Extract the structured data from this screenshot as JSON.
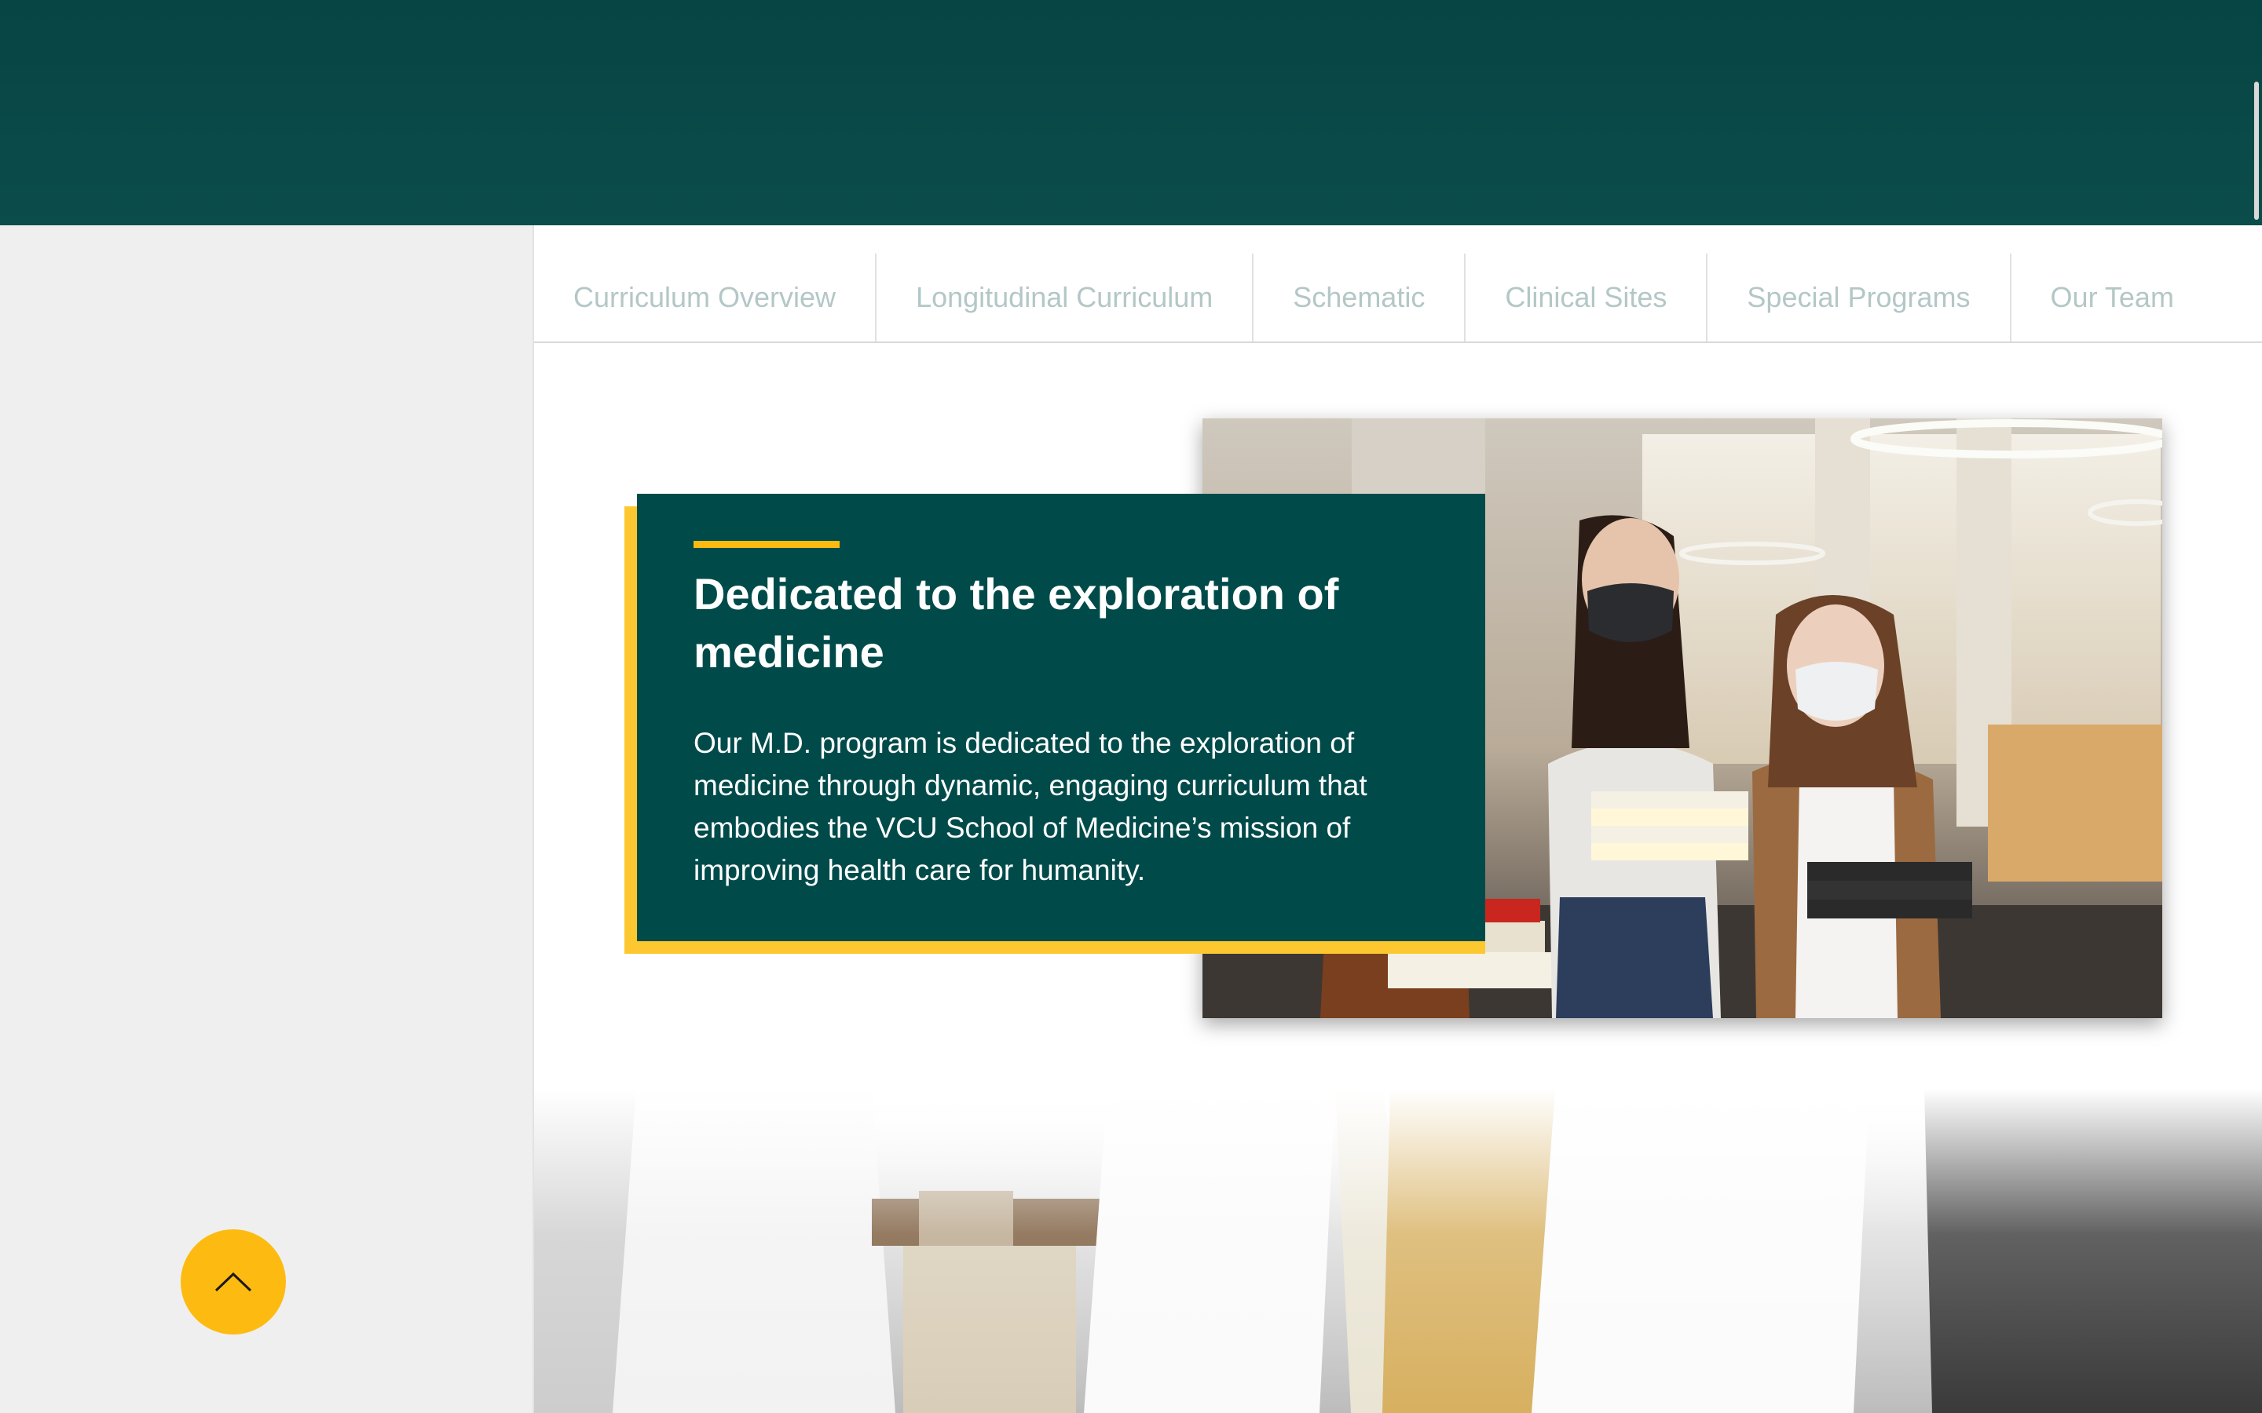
{
  "tabs": [
    {
      "label": "Curriculum Overview"
    },
    {
      "label": "Longitudinal Curriculum"
    },
    {
      "label": "Schematic"
    },
    {
      "label": "Clinical Sites"
    },
    {
      "label": "Special Programs"
    },
    {
      "label": "Our Team"
    }
  ],
  "feature": {
    "heading": "Dedicated to the exploration of medicine",
    "body": "Our M.D. program is dedicated to the exploration of medicine through dynamic, engaging curriculum that embodies the VCU School of Medicine’s mission of improving health care for humanity."
  },
  "icons": {
    "back_to_top": "chevron-up-icon"
  },
  "colors": {
    "banner": "#074444",
    "card": "#004b4a",
    "accent": "#fdc82f",
    "back_to_top": "#fdbb11",
    "tab_text": "#b3c7c6"
  }
}
